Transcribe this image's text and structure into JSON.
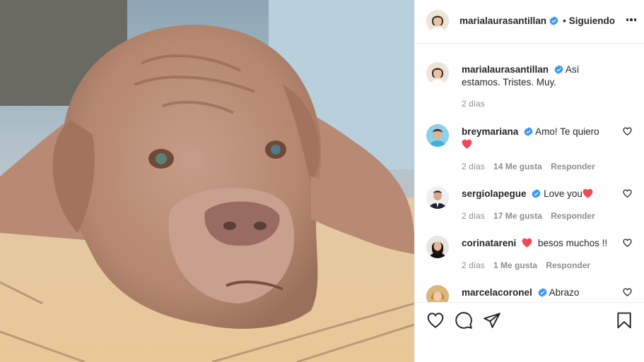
{
  "post": {
    "photo_alt": "",
    "author": {
      "username": "marialaurasantillan",
      "verified": true,
      "follow_separator": "•",
      "follow_status": "Siguiendo"
    },
    "caption": {
      "username": "marialaurasantillan",
      "text": "Así estamos. Tristes. Muy.",
      "time": "2 días"
    },
    "comments": [
      {
        "username": "breymariana",
        "verified": true,
        "text": "Amo! Te quiero",
        "emoji": "red-heart",
        "time": "2 días",
        "likes": "14 Me gusta",
        "reply": "Responder"
      },
      {
        "username": "sergiolapegue",
        "verified": true,
        "text": "Love you",
        "emoji": "red-heart",
        "time": "2 días",
        "likes": "17 Me gusta",
        "reply": "Responder"
      },
      {
        "username": "corinatareni",
        "verified": false,
        "text": "besos muchos !!",
        "emoji": "red-heart",
        "time": "2 días",
        "likes": "1 Me gusta",
        "reply": "Responder"
      },
      {
        "username": "marcelacoronel",
        "verified": true,
        "text": "Abrazo"
      }
    ],
    "icons": {
      "like": "heart-outline-icon",
      "comment": "speech-bubble-icon",
      "share": "paper-plane-icon",
      "save": "bookmark-icon"
    },
    "colors": {
      "verified": "#3897f0",
      "red_heart": "#ed4956",
      "meta_gray": "#8e8e8e"
    }
  }
}
